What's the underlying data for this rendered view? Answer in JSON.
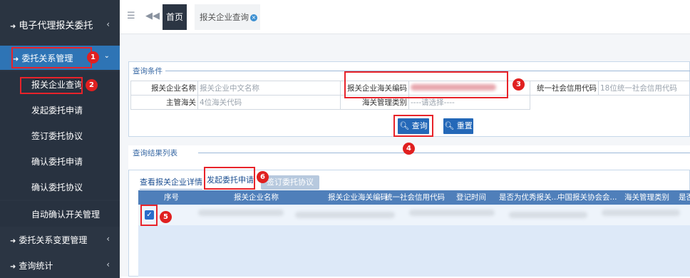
{
  "sidebar": {
    "title": "电子代理报关委托",
    "groups": [
      {
        "label": "委托关系管理"
      },
      {
        "label": "委托关系变更管理"
      },
      {
        "label": "查询统计"
      }
    ],
    "items": [
      {
        "label": "报关企业查询"
      },
      {
        "label": "发起委托申请"
      },
      {
        "label": "签订委托协议"
      },
      {
        "label": "确认委托申请"
      },
      {
        "label": "确认委托协议"
      },
      {
        "label": "自动确认开关管理"
      }
    ]
  },
  "topbar": {
    "home_tab": "首页",
    "current_tab": "报关企业查询"
  },
  "query": {
    "legend": "查询条件",
    "name_label": "报关企业名称",
    "name_placeholder": "报关企业中文名称",
    "code_label": "报关企业海关编码",
    "credit_label": "统一社会信用代码",
    "credit_placeholder": "18位统一社会信用代码",
    "customs_label": "主管海关",
    "customs_placeholder": "4位海关代码",
    "category_label": "海关管理类别",
    "category_value": "----请选择----",
    "search_button": "查询",
    "reset_button": "重置"
  },
  "results": {
    "legend": "查询结果列表",
    "tabs": [
      "查看报关企业详情",
      "发起委托申请",
      "签订委托协议"
    ],
    "columns": [
      "序号",
      "报关企业名称",
      "报关企业海关编码",
      "统一社会信用代码",
      "登记时间",
      "是否为优秀报关...",
      "中国报关协会会...",
      "海关管理类别",
      "是否"
    ]
  },
  "annotations": [
    "1",
    "2",
    "3",
    "4",
    "5",
    "6"
  ],
  "colors": {
    "sidebar_bg": "#2b3543",
    "accent": "#2e74b5",
    "annotation_red": "#e8232a",
    "grid_header": "#4f7fba"
  }
}
